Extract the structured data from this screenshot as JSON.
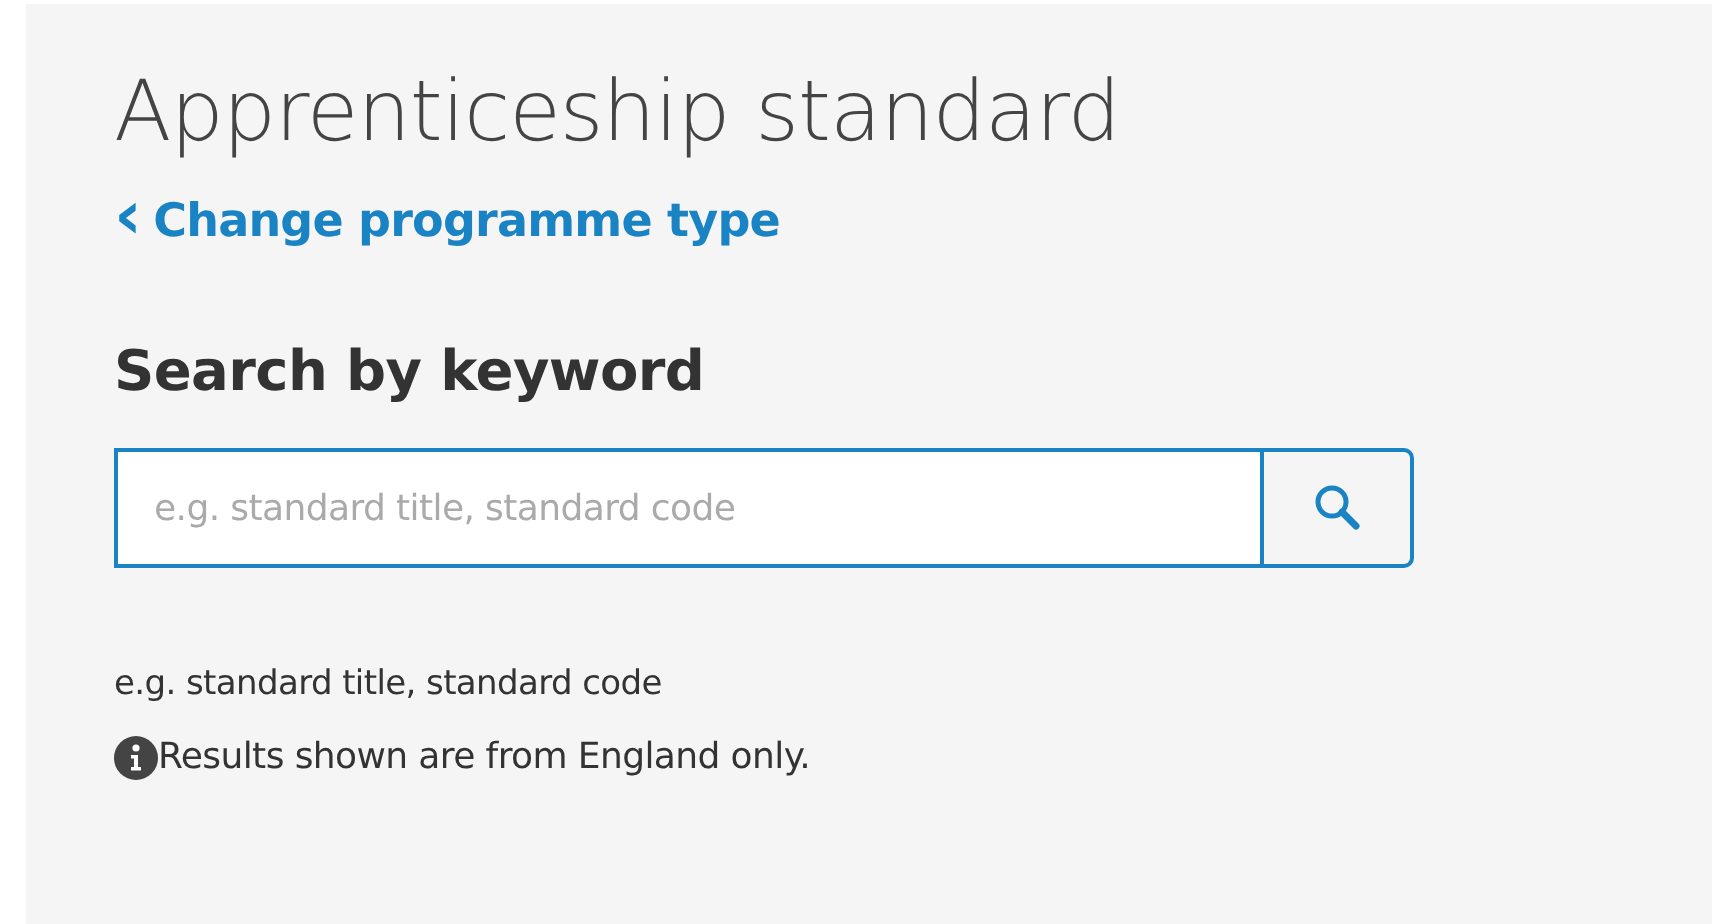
{
  "page": {
    "title": "Apprenticeship standard",
    "back_link": {
      "icon": "‹",
      "label": "Change programme type"
    }
  },
  "search": {
    "heading": "Search by keyword",
    "placeholder": "e.g. standard title, standard code",
    "hint": "e.g. standard title, standard code"
  },
  "notice": {
    "text": "Results shown are from England only."
  }
}
